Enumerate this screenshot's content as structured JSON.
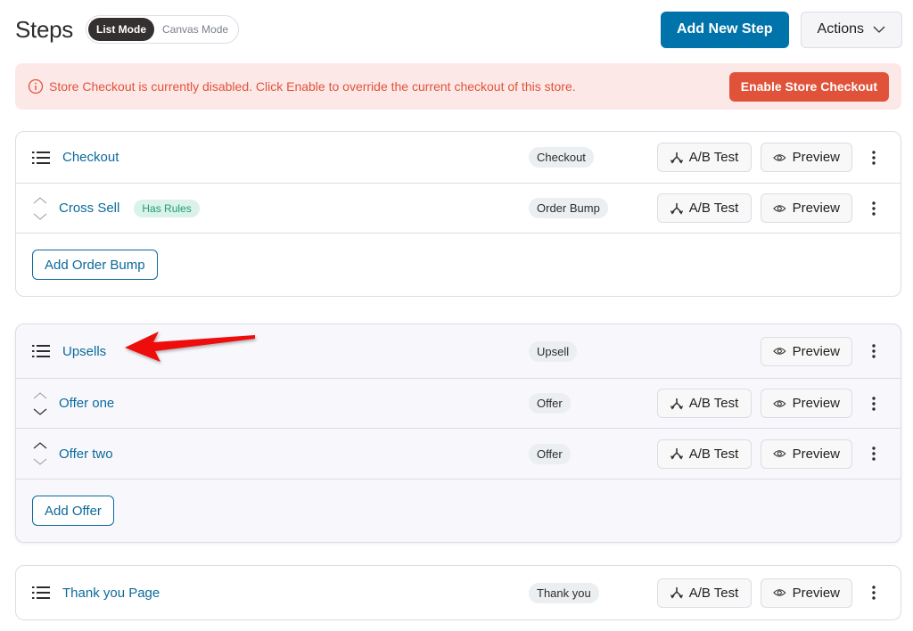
{
  "header": {
    "title": "Steps",
    "modes": [
      "List Mode",
      "Canvas Mode"
    ],
    "active_mode": "List Mode",
    "add_step_label": "Add New Step",
    "actions_label": "Actions"
  },
  "notice": {
    "text": "Store Checkout is currently disabled. Click Enable to override the current checkout of this store.",
    "button_label": "Enable Store Checkout",
    "color": "#e0533a"
  },
  "groups": [
    {
      "rows": [
        {
          "name": "Checkout",
          "type": "Checkout",
          "lead": "list-icon",
          "ab_test": true
        },
        {
          "name": "Cross Sell",
          "badge": "Has Rules",
          "type": "Order Bump",
          "lead": "reorder-arrows",
          "ab_test": true
        }
      ],
      "footer_button": "Add Order Bump"
    },
    {
      "rows": [
        {
          "name": "Upsells",
          "type": "Upsell",
          "lead": "list-icon",
          "ab_test": false
        },
        {
          "name": "Offer one",
          "type": "Offer",
          "lead": "reorder-arrows",
          "ab_test": true
        },
        {
          "name": "Offer two",
          "type": "Offer",
          "lead": "reorder-arrows",
          "ab_test": true
        }
      ],
      "footer_button": "Add Offer"
    },
    {
      "rows": [
        {
          "name": "Thank you Page",
          "type": "Thank you",
          "lead": "list-icon",
          "ab_test": true
        }
      ]
    }
  ],
  "row_buttons": {
    "ab_test": "A/B Test",
    "preview": "Preview"
  },
  "colors": {
    "primary": "#0073aa",
    "link": "#0b6a9b",
    "annotation_arrow": "#ee1111"
  }
}
